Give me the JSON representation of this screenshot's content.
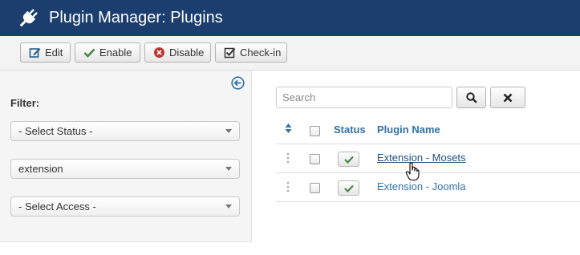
{
  "header": {
    "title": "Plugin Manager: Plugins",
    "icon": "plug-icon"
  },
  "toolbar": {
    "edit_label": "Edit",
    "enable_label": "Enable",
    "disable_label": "Disable",
    "checkin_label": "Check-in"
  },
  "sidebar": {
    "filter_label": "Filter:",
    "status_select": "- Select Status -",
    "folder_select": "extension",
    "access_select": "- Select Access -"
  },
  "search": {
    "placeholder": "Search",
    "value": ""
  },
  "table": {
    "columns": {
      "status": "Status",
      "name": "Plugin Name"
    },
    "rows": [
      {
        "name": "Extension - Mosets",
        "enabled": true,
        "checked": false
      },
      {
        "name": "Extension - Joomla",
        "enabled": true,
        "checked": false
      }
    ]
  },
  "colors": {
    "header_bg": "#1b3e6f",
    "link": "#3071a9",
    "enabled_check": "#468847",
    "disable_icon": "#bd362f"
  }
}
